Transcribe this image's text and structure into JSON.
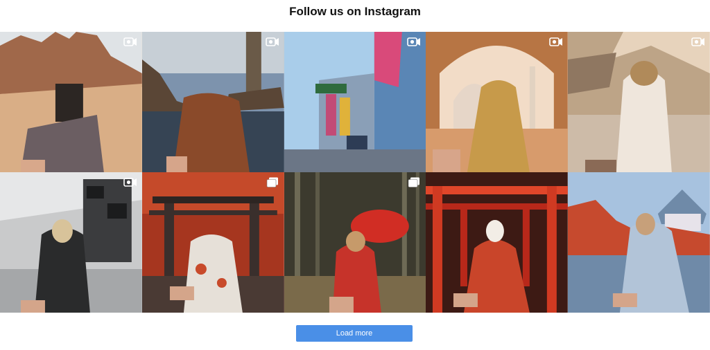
{
  "header": {
    "title": "Follow us on Instagram"
  },
  "posts": [
    {
      "badge": "video-icon",
      "scene": "desert-canyon",
      "colors": [
        "#e7c7a4",
        "#c98a5e",
        "#8e5a3c",
        "#4a3a36"
      ]
    },
    {
      "badge": "video-icon",
      "scene": "coastal-lighthouse",
      "colors": [
        "#7f95b3",
        "#6d5c4b",
        "#2e3b4d",
        "#8c4a2a"
      ]
    },
    {
      "badge": "video-icon",
      "scene": "colorful-city",
      "colors": [
        "#9cc3e6",
        "#5d8bb8",
        "#c24b76",
        "#2d3c55"
      ]
    },
    {
      "badge": "video-icon",
      "scene": "taj-mahal",
      "colors": [
        "#f0cfb2",
        "#d99b6f",
        "#b77544",
        "#7a4a2c"
      ]
    },
    {
      "badge": "video-icon",
      "scene": "modern-architecture",
      "colors": [
        "#e9d5bd",
        "#b79a7d",
        "#6f5846",
        "#f4ede4"
      ]
    },
    {
      "badge": "video-icon",
      "scene": "airport-luggage",
      "colors": [
        "#c9cacb",
        "#8f9193",
        "#3b3c3e",
        "#1b1c1d"
      ]
    },
    {
      "badge": "gallery-icon",
      "scene": "torii-autumn",
      "colors": [
        "#a6361f",
        "#d45a2e",
        "#3a2f2c",
        "#e6e0d8"
      ]
    },
    {
      "badge": "gallery-icon",
      "scene": "bamboo-umbrella",
      "colors": [
        "#4c4a3a",
        "#7a6a4a",
        "#d12d24",
        "#2c2a22"
      ]
    },
    {
      "badge": "none",
      "scene": "fushimi-inari",
      "colors": [
        "#b8281a",
        "#e0462a",
        "#3d1a14",
        "#f2ede6"
      ]
    },
    {
      "badge": "none",
      "scene": "osaka-castle",
      "colors": [
        "#9fb9d8",
        "#c64a2e",
        "#6f8aa8",
        "#e7e3ea"
      ]
    }
  ],
  "actions": {
    "load_more_label": "Load more"
  }
}
